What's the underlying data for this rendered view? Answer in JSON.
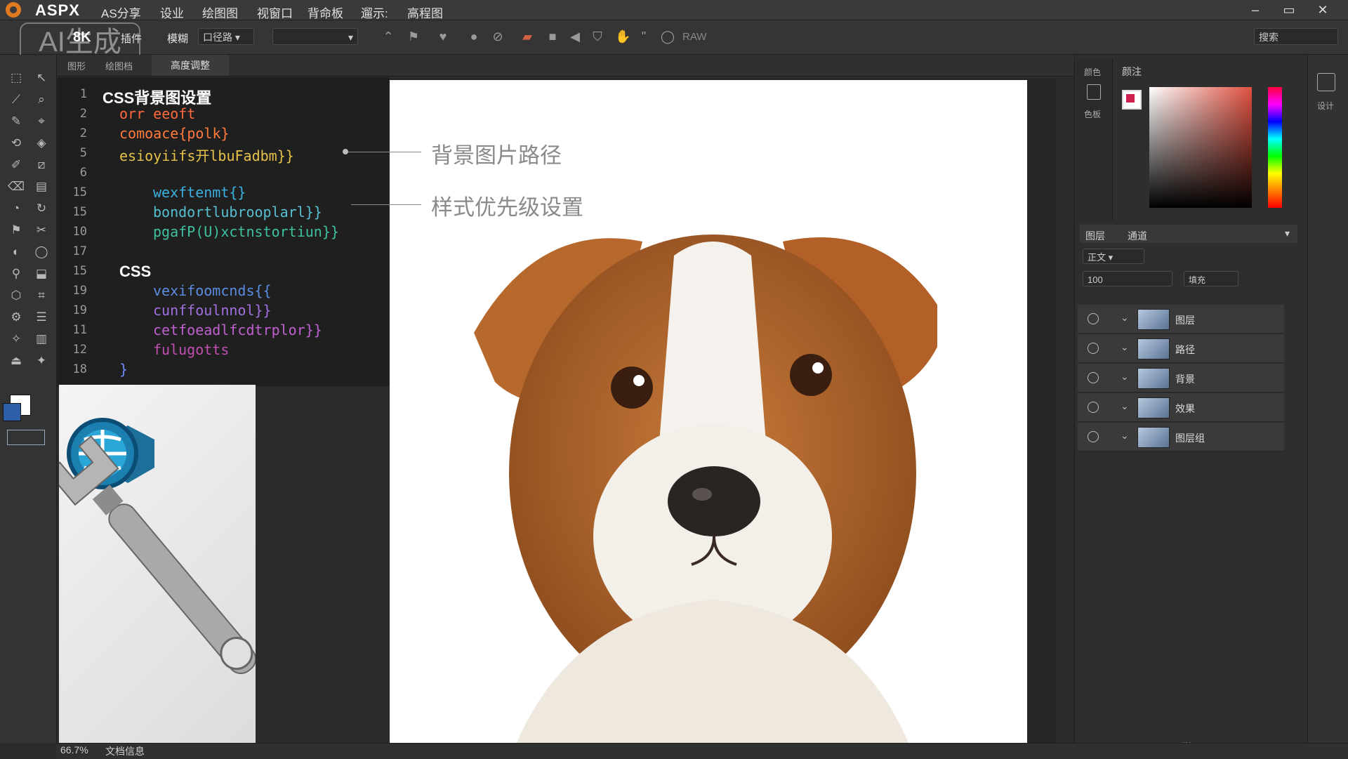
{
  "app": {
    "name": "ASPX",
    "menu": [
      "AS分享",
      "设业",
      "绘图图",
      "视窗口",
      "背命板",
      "遛示:",
      "高程图"
    ]
  },
  "watermark": "AI生成",
  "options_bar": {
    "resolution": "8K",
    "mode": "插件",
    "mode_dropdown_label": "模糊",
    "mode_dropdown_value": "口径路",
    "preview_label": "RAW",
    "search_label": "搜索"
  },
  "doc_tabs": [
    "图形",
    "绘图档",
    "高度调整"
  ],
  "editor": {
    "line_numbers": [
      "1",
      "2",
      "2",
      "5",
      "6",
      "15",
      "15",
      "10",
      "17",
      "15",
      "19",
      "19",
      "11",
      "12",
      "18"
    ],
    "lines": [
      {
        "text": "CSS背景图设置",
        "color": "#ffffff"
      },
      {
        "text": "orr eeoft",
        "color": "#ff6a3d"
      },
      {
        "text": "comoace{polk}",
        "color": "#ff7a3d"
      },
      {
        "text": "esioyiifs开lbuFadbm}}",
        "color": "#e6c24a"
      },
      {
        "text": "",
        "color": "#ffffff"
      },
      {
        "text": "wexftenmt{}",
        "color": "#3bb0e0"
      },
      {
        "text": "bondortlubrooplarl}}",
        "color": "#56c0d0"
      },
      {
        "text": "pgafP(U)xctnstortiun}}",
        "color": "#3fc0a0"
      },
      {
        "text": "",
        "color": "#ffffff"
      },
      {
        "text": "CSS",
        "color": "#ffffff"
      },
      {
        "text": "vexifoomcnds{{",
        "color": "#5a8ce0"
      },
      {
        "text": "cunffoulnnol}}",
        "color": "#a070e0"
      },
      {
        "text": "cetfoeadlfcdtrplor}}",
        "color": "#c060d0"
      },
      {
        "text": "fulugotts",
        "color": "#c050b0"
      },
      {
        "text": "}",
        "color": "#6a8cff"
      }
    ]
  },
  "annotations": [
    "背景图片路径",
    "样式优先级设置"
  ],
  "right_panel": {
    "tab_left_top": "颜色",
    "tab_left_bottom": "色板",
    "color_tab": "颜注",
    "layers_tabs": [
      "图层",
      "通道"
    ],
    "blend_mode": "正文",
    "opacity": "100",
    "fill_label": "填充",
    "layers": [
      "图层",
      "路径",
      "背景",
      "效果",
      "图层组"
    ],
    "far_right_label": "设计"
  },
  "status": {
    "zoom": "66.7%",
    "doc_info": "文档信息"
  },
  "colors": {
    "accent_orange": "#e07a1f",
    "canvas_bg": "#ffffff",
    "panel_bg": "#2e2e2e"
  }
}
